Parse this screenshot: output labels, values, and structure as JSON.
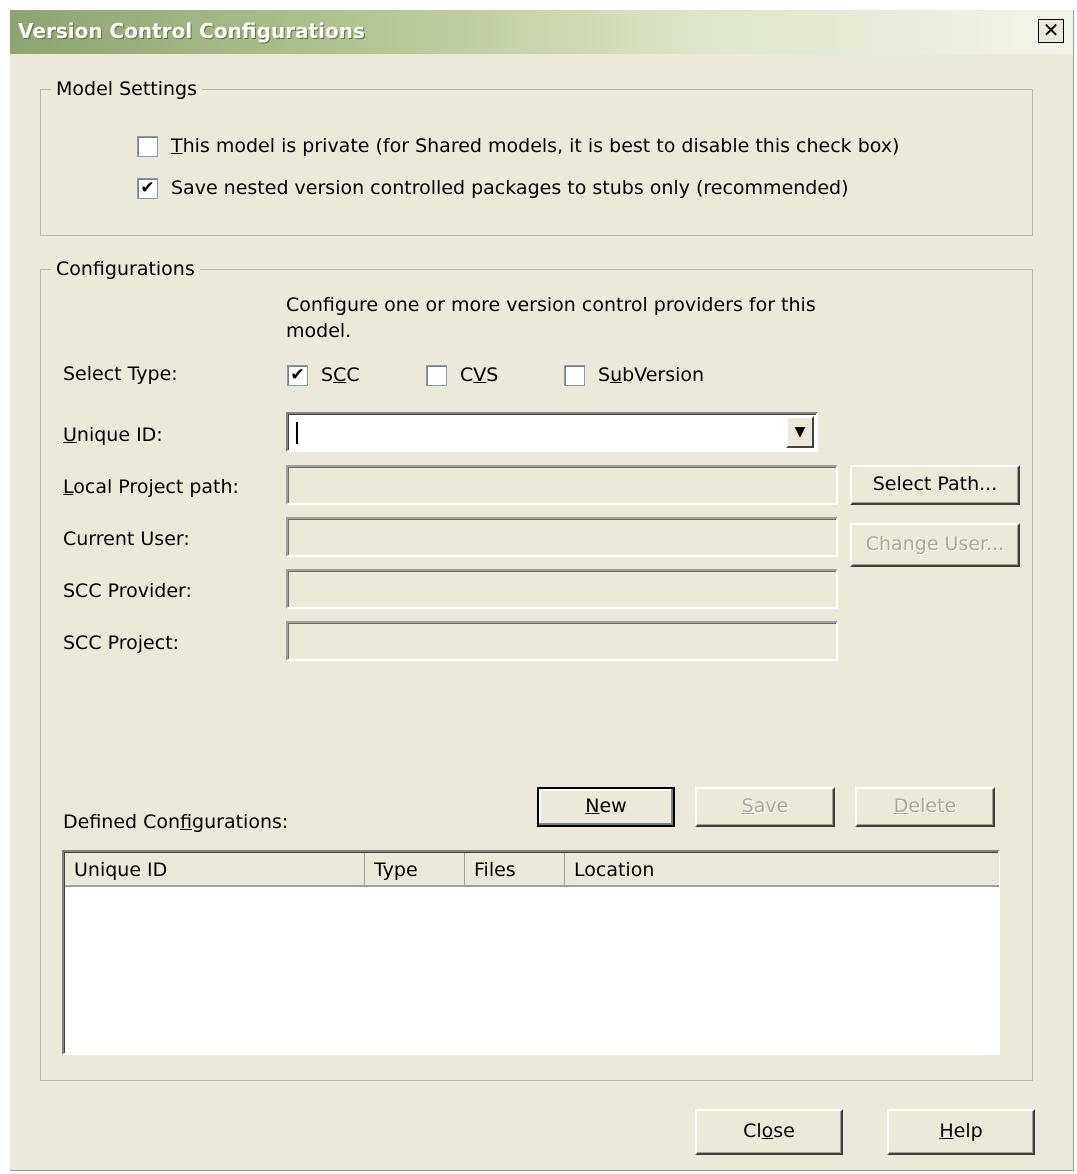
{
  "window": {
    "title": "Version Control Configurations",
    "close_glyph": "✕"
  },
  "model_settings": {
    "legend": "Model Settings",
    "private_checkbox": {
      "checked": false,
      "label_pre": "",
      "label_accel": "T",
      "label_post": "his model is private (for Shared models, it is best to disable this check box)"
    },
    "stubs_checkbox": {
      "checked": true,
      "label": "Save nested version controlled packages to stubs only (recommended)"
    }
  },
  "configurations": {
    "legend": "Configurations",
    "hint_line1": "Configure one or more version control providers for this",
    "hint_line2": "model.",
    "select_type_label": "Select Type:",
    "types": [
      {
        "pre": "S",
        "accel": "C",
        "post": "C",
        "checked": true
      },
      {
        "pre": "C",
        "accel": "V",
        "post": "S",
        "checked": false
      },
      {
        "pre": "S",
        "accel": "u",
        "post": "bVersion",
        "checked": false
      }
    ],
    "unique_id": {
      "pre": "",
      "accel": "U",
      "post": "nique ID:",
      "value": ""
    },
    "local_path": {
      "pre": "",
      "accel": "L",
      "post": "ocal Project path:",
      "value": ""
    },
    "current_user": {
      "label": "Current User:",
      "value": ""
    },
    "scc_provider": {
      "label": "SCC Provider:",
      "value": ""
    },
    "scc_project": {
      "label": "SCC Project:",
      "value": ""
    },
    "select_path_button": "Select Path...",
    "change_user_button": {
      "pre": "Chan",
      "accel": "g",
      "post": "e User..."
    },
    "defined_label": {
      "pre": "Defined Con",
      "accel": "f",
      "post": "igurations:"
    },
    "new_button": {
      "pre": "",
      "accel": "N",
      "post": "ew"
    },
    "save_button": {
      "pre": "",
      "accel": "S",
      "post": "ave"
    },
    "delete_button": {
      "pre": "",
      "accel": "D",
      "post": "elete"
    },
    "table": {
      "columns": [
        "Unique ID",
        "Type",
        "Files",
        "Location"
      ],
      "rows": []
    }
  },
  "footer": {
    "close_button": {
      "pre": "Cl",
      "accel": "o",
      "post": "se"
    },
    "help_button": {
      "pre": "",
      "accel": "H",
      "post": "elp"
    }
  },
  "icons": {
    "check": "✔",
    "dropdown": "▼"
  }
}
